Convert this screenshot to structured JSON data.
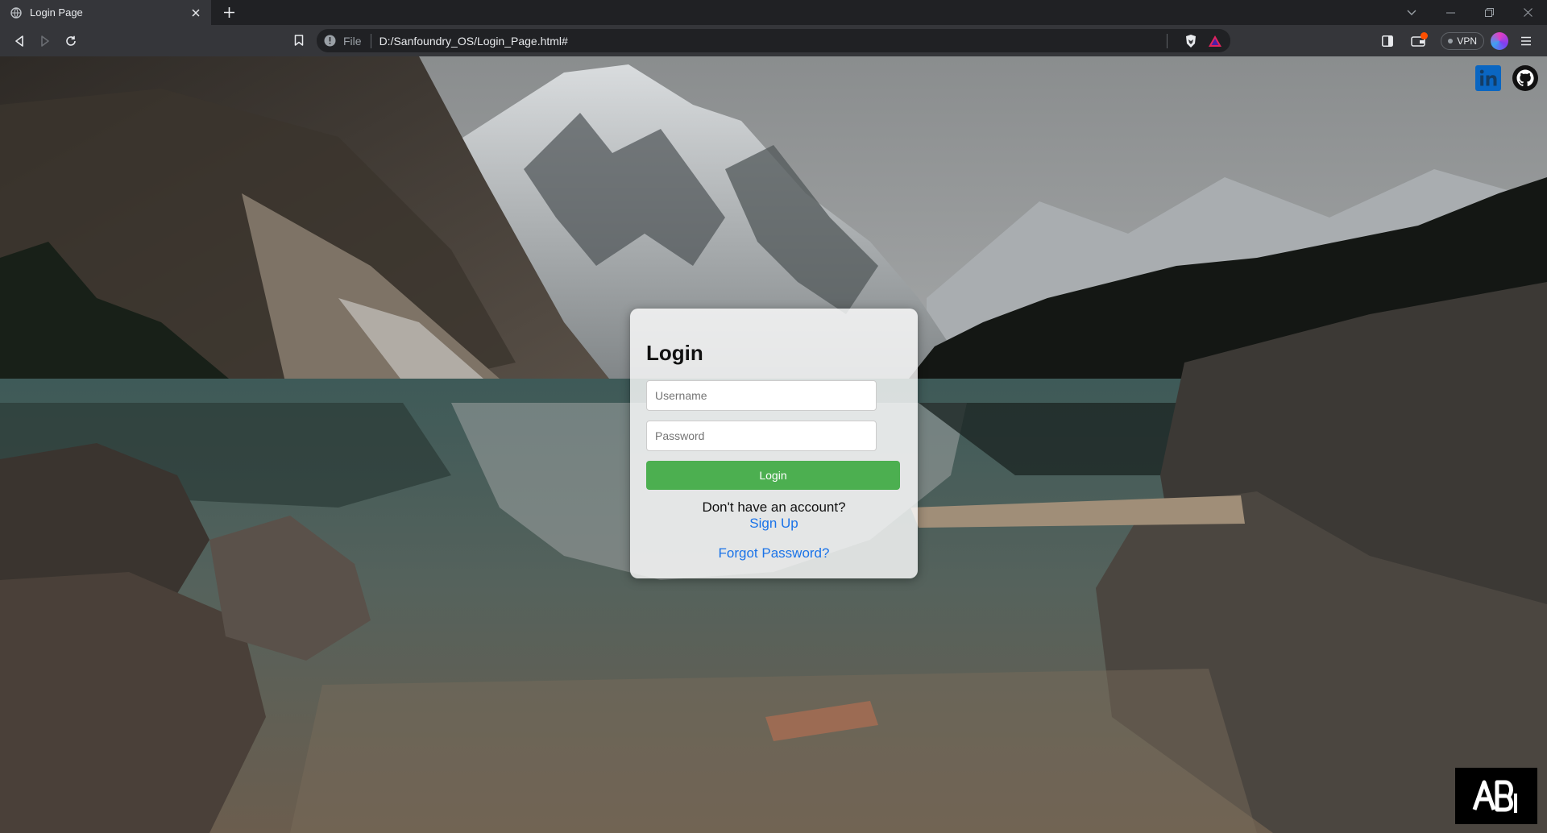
{
  "browser": {
    "tab": {
      "title": "Login Page",
      "favicon": "globe-icon"
    },
    "address_bar": {
      "scheme": "File",
      "url": "D:/Sanfoundry_OS/Login_Page.html#"
    },
    "vpn_label": "VPN",
    "accent_colors": {
      "notification": "#ff5000"
    }
  },
  "page": {
    "social_links": [
      {
        "name": "linkedin",
        "label": "in",
        "color": "#0a66c2"
      },
      {
        "name": "github",
        "color": "#111111"
      }
    ],
    "login": {
      "heading": "Login",
      "username_placeholder": "Username",
      "password_placeholder": "Password",
      "login_button": "Login",
      "signup_prompt": "Don't have an account?",
      "signup_link": "Sign Up",
      "forgot_link": "Forgot Password?"
    },
    "colors": {
      "button": "#4caf50",
      "link": "#1a73e8"
    },
    "brand_badge": {
      "text": "AB",
      "sub": "I"
    }
  }
}
